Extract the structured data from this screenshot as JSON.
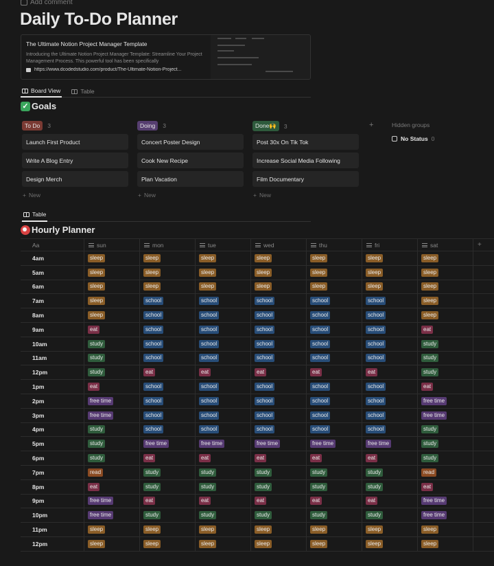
{
  "header": {
    "add_comment": "Add comment",
    "title": "Daily To-Do Planner"
  },
  "bookmark": {
    "title": "The Ultimate Notion Project Manager Template",
    "description": "Introducing the Ultimate Notion Project Manager Template: Streamline Your Project Management Process. This powerful tool has been specifically",
    "url": "https://www.dcodedstudio.com/product/The-Ultimate-Notion-Project..."
  },
  "views": {
    "board": "Board View",
    "table": "Table"
  },
  "goals": {
    "title": "Goals",
    "groups": [
      {
        "name": "To Do",
        "count": "3",
        "color": "#7a3a33",
        "cards": [
          "Launch First Product",
          "Write A Blog Entry",
          "Design Merch"
        ],
        "new_label": "New"
      },
      {
        "name": "Doing",
        "count": "3",
        "color": "#563e70",
        "cards": [
          "Concert Poster Design",
          "Cook New Recipe",
          "Plan Vacation"
        ],
        "new_label": "New"
      },
      {
        "name": "Done🙌",
        "count": "3",
        "color": "#2e5a3c",
        "cards": [
          "Post 30x On Tik Tok",
          "Increase Social Media Following",
          "Film Documentary"
        ],
        "new_label": "New"
      }
    ],
    "add_group": "+",
    "hidden_groups": "Hidden groups",
    "no_status": {
      "label": "No Status",
      "count": "0"
    }
  },
  "planner": {
    "table_tab": "Table",
    "title": "Hourly Planner",
    "columns": [
      "Aa",
      "sun",
      "mon",
      "tue",
      "wed",
      "thu",
      "fri",
      "sat"
    ],
    "add_column": "+",
    "tag_colors": {
      "sleep": "#8a5d27",
      "school": "#284d78",
      "eat": "#7a2f47",
      "study": "#2f5c3c",
      "free time": "#563a72",
      "read": "#8a4a22"
    },
    "rows": [
      {
        "time": "4am",
        "days": [
          "sleep",
          "sleep",
          "sleep",
          "sleep",
          "sleep",
          "sleep",
          "sleep"
        ]
      },
      {
        "time": "5am",
        "days": [
          "sleep",
          "sleep",
          "sleep",
          "sleep",
          "sleep",
          "sleep",
          "sleep"
        ]
      },
      {
        "time": "6am",
        "days": [
          "sleep",
          "sleep",
          "sleep",
          "sleep",
          "sleep",
          "sleep",
          "sleep"
        ]
      },
      {
        "time": "7am",
        "days": [
          "sleep",
          "school",
          "school",
          "school",
          "school",
          "school",
          "sleep"
        ]
      },
      {
        "time": "8am",
        "days": [
          "sleep",
          "school",
          "school",
          "school",
          "school",
          "school",
          "sleep"
        ]
      },
      {
        "time": "9am",
        "days": [
          "eat",
          "school",
          "school",
          "school",
          "school",
          "school",
          "eat"
        ]
      },
      {
        "time": "10am",
        "days": [
          "study",
          "school",
          "school",
          "school",
          "school",
          "school",
          "study"
        ]
      },
      {
        "time": "11am",
        "days": [
          "study",
          "school",
          "school",
          "school",
          "school",
          "school",
          "study"
        ]
      },
      {
        "time": "12pm",
        "days": [
          "study",
          "eat",
          "eat",
          "eat",
          "eat",
          "eat",
          "study"
        ]
      },
      {
        "time": "1pm",
        "days": [
          "eat",
          "school",
          "school",
          "school",
          "school",
          "school",
          "eat"
        ]
      },
      {
        "time": "2pm",
        "days": [
          "free time",
          "school",
          "school",
          "school",
          "school",
          "school",
          "free time"
        ]
      },
      {
        "time": "3pm",
        "days": [
          "free time",
          "school",
          "school",
          "school",
          "school",
          "school",
          "free time"
        ]
      },
      {
        "time": "4pm",
        "days": [
          "study",
          "school",
          "school",
          "school",
          "school",
          "school",
          "study"
        ]
      },
      {
        "time": "5pm",
        "days": [
          "study",
          "free time",
          "free time",
          "free time",
          "free time",
          "free time",
          "study"
        ]
      },
      {
        "time": "6pm",
        "days": [
          "study",
          "eat",
          "eat",
          "eat",
          "eat",
          "eat",
          "study"
        ]
      },
      {
        "time": "7pm",
        "days": [
          "read",
          "study",
          "study",
          "study",
          "study",
          "study",
          "read"
        ]
      },
      {
        "time": "8pm",
        "days": [
          "eat",
          "study",
          "study",
          "study",
          "study",
          "study",
          "eat"
        ]
      },
      {
        "time": "9pm",
        "days": [
          "free time",
          "eat",
          "eat",
          "eat",
          "eat",
          "eat",
          "free time"
        ]
      },
      {
        "time": "10pm",
        "days": [
          "free time",
          "study",
          "study",
          "study",
          "study",
          "study",
          "free time"
        ]
      },
      {
        "time": "11pm",
        "days": [
          "sleep",
          "sleep",
          "sleep",
          "sleep",
          "sleep",
          "sleep",
          "sleep"
        ]
      },
      {
        "time": "12pm",
        "days": [
          "sleep",
          "sleep",
          "sleep",
          "sleep",
          "sleep",
          "sleep",
          "sleep"
        ]
      }
    ]
  }
}
